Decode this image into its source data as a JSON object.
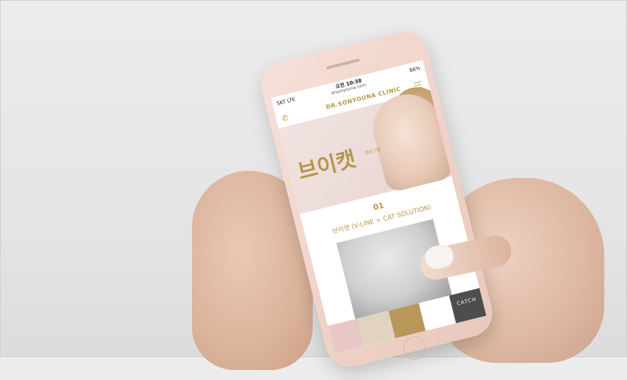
{
  "status": {
    "carrier": "SKT LTE",
    "time": "오전 10:38",
    "url": "drsonyouna.com",
    "battery": "86%"
  },
  "header": {
    "logo": "DR.SONYOUNA CLINIC"
  },
  "hero": {
    "title": "브이캣",
    "tag": "프로그램"
  },
  "section": {
    "number": "01",
    "title": "브이캣 (V-LINE + CAT SOLUTION)"
  },
  "tabs": [
    "",
    "",
    "",
    "",
    "CATCH"
  ],
  "icons": [
    "phone-icon",
    "menu-icon",
    "location-icon",
    "calendar-icon",
    "card-icon"
  ]
}
